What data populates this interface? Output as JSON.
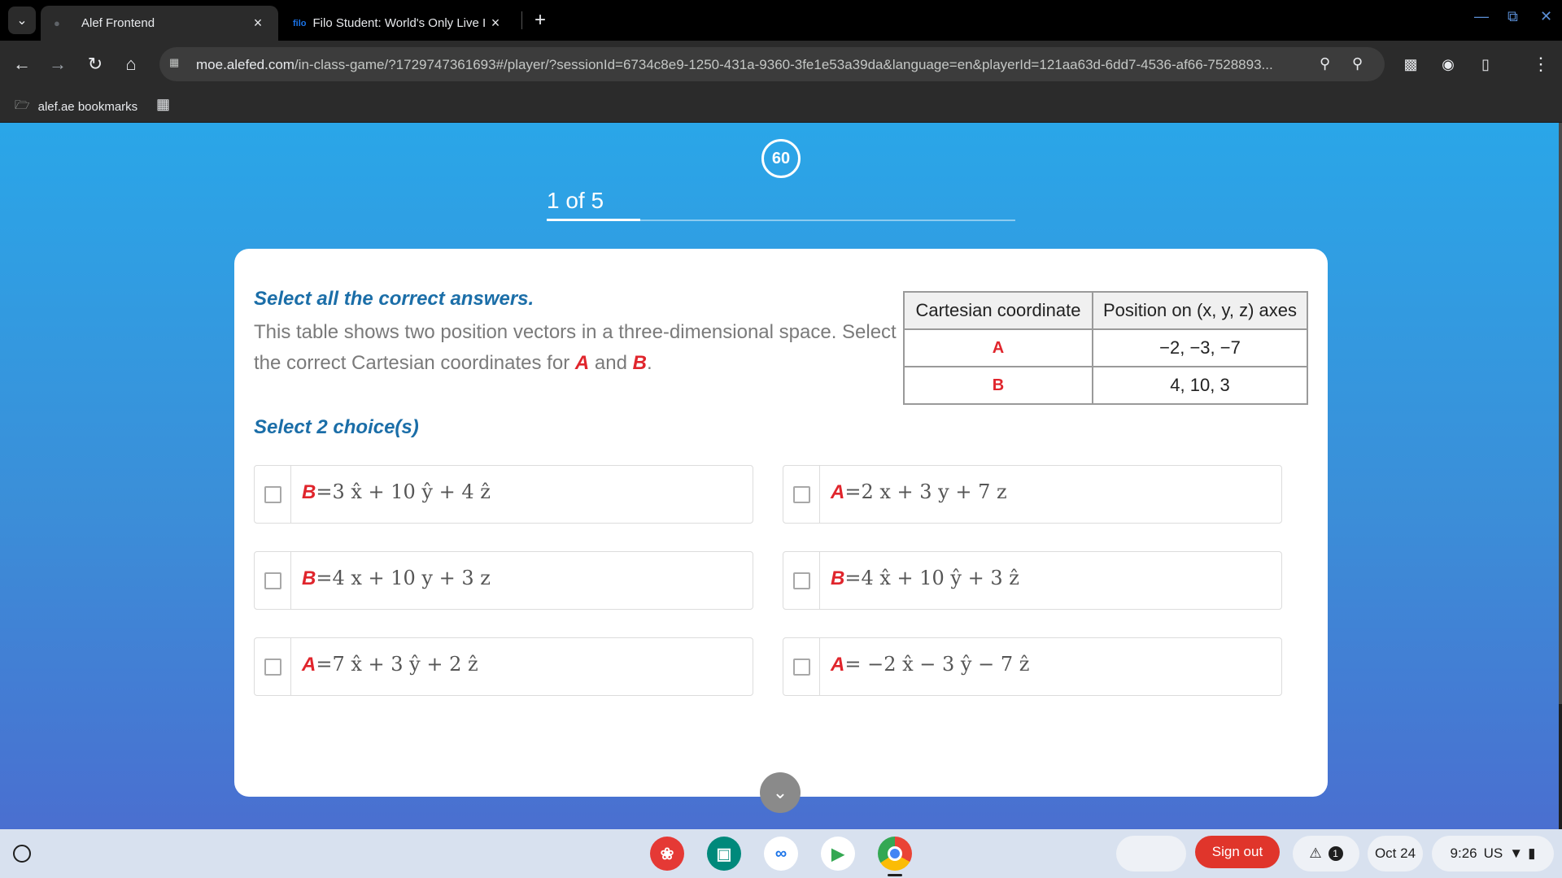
{
  "browser": {
    "tabs": [
      {
        "label": "Alef Frontend",
        "active": true
      },
      {
        "label": "Filo Student: World's Only Live I",
        "favicon_text": "filo",
        "active": false
      }
    ],
    "url_host": "moe.alefed.com",
    "url_path": "/in-class-game/?1729747361693#/player/?sessionId=6734c8e9-1250-431a-9360-3fe1e53a39da&language=en&playerId=121aa63d-6dd7-4536-af66-7528893...",
    "bookmark_label": "alef.ae bookmarks"
  },
  "game": {
    "timer": "60",
    "progress_label": "1 of 5",
    "progress_fraction": 0.2
  },
  "question": {
    "instruction": "Select all the correct answers.",
    "text_before": "This table shows two position vectors in a three-dimensional space. Select the correct Cartesian coordinates for ",
    "var_a": "A",
    "text_and": " and ",
    "var_b": "B",
    "text_end": ".",
    "choice_count": "Select 2 choice(s)"
  },
  "table": {
    "headers": [
      "Cartesian coordinate",
      "Position on (x, y, z) axes"
    ],
    "rows": [
      {
        "label": "A",
        "value": "−2, −3, −7"
      },
      {
        "label": "B",
        "value": "4, 10, 3"
      }
    ]
  },
  "options": [
    {
      "var": "B",
      "expr": "=3 x̂ + 10 ŷ + 4 ẑ"
    },
    {
      "var": "A",
      "expr": "=2 x + 3 y + 7 z"
    },
    {
      "var": "B",
      "expr": "=4 x + 10 y + 3 z"
    },
    {
      "var": "B",
      "expr": "=4 x̂ + 10 ŷ + 3 ẑ"
    },
    {
      "var": "A",
      "expr": "=7 x̂ + 3 ŷ + 2 ẑ"
    },
    {
      "var": "A",
      "expr": "= −2 x̂ − 3 ŷ − 7 ẑ"
    }
  ],
  "shelf": {
    "sign_out": "Sign out",
    "notification_count": "1",
    "date": "Oct 24",
    "time": "9:26",
    "locale": "US"
  },
  "colors": {
    "accent_blue": "#1b6ea8",
    "variable_red": "#e0252c",
    "sign_out_red": "#e0352b"
  }
}
